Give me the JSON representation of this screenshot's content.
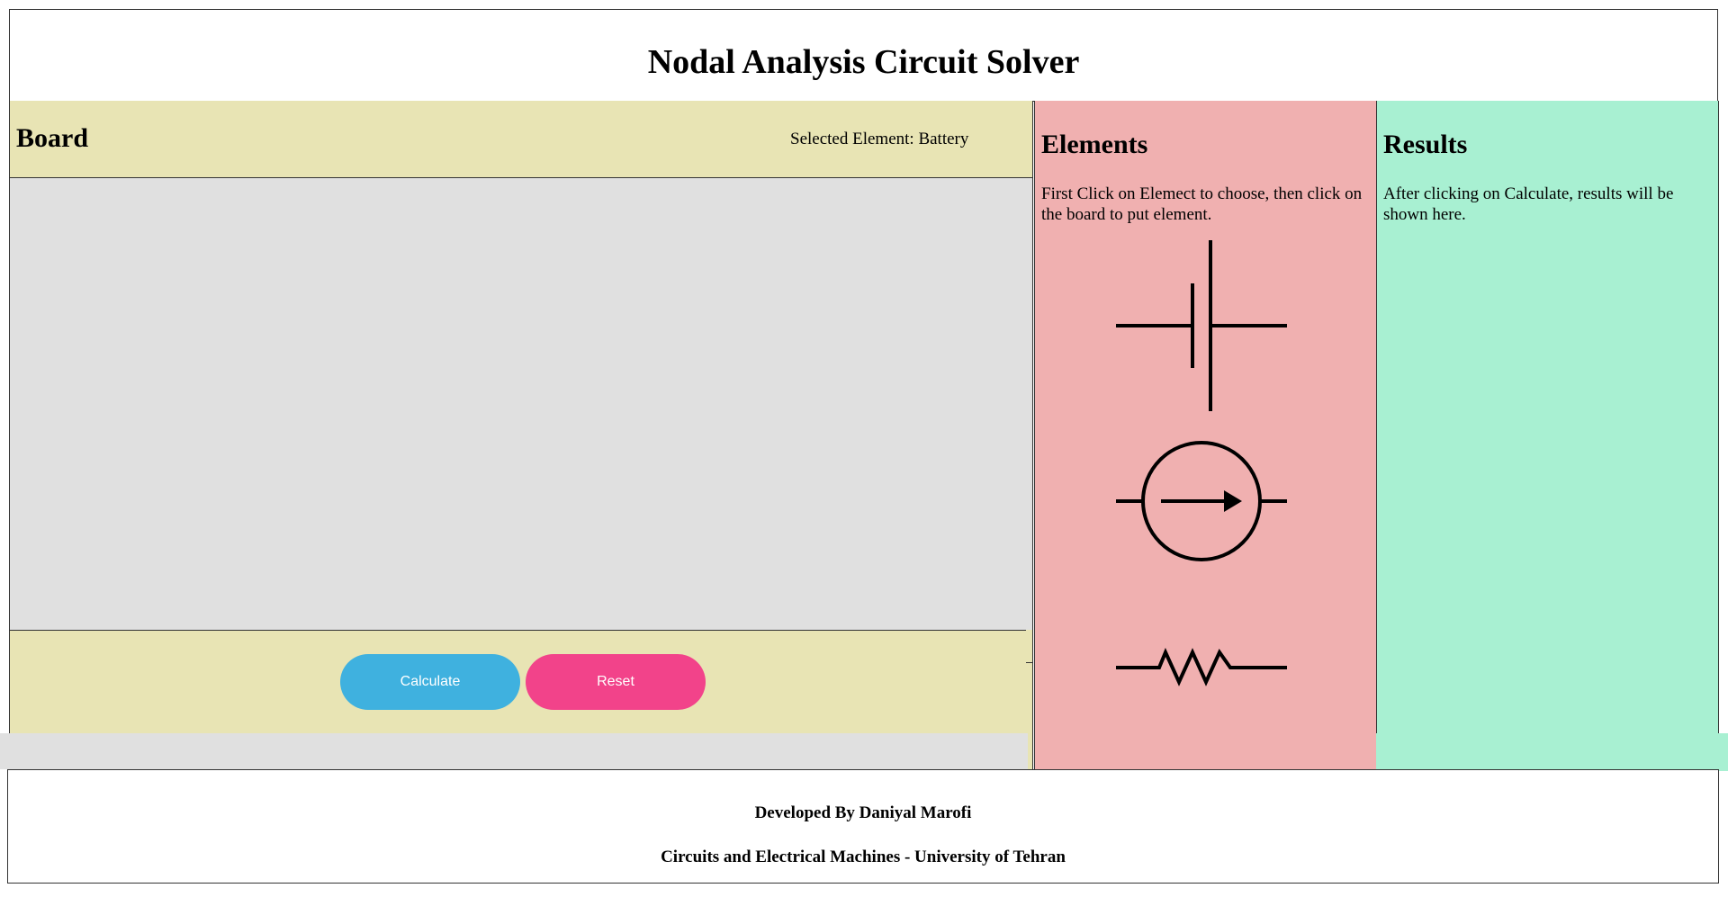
{
  "header": {
    "title": "Nodal Analysis Circuit Solver"
  },
  "board": {
    "title": "Board",
    "selected_label": "Selected Element: Battery",
    "calculate_label": "Calculate",
    "reset_label": "Reset"
  },
  "elements": {
    "title": "Elements",
    "instructions": "First Click on Elemect to choose, then click on the board to put element.",
    "items": [
      {
        "icon": "battery-icon"
      },
      {
        "icon": "current-source-icon"
      },
      {
        "icon": "resistor-icon"
      }
    ]
  },
  "results": {
    "title": "Results",
    "text": "After clicking on Calculate, results will be shown here."
  },
  "footer": {
    "developer": "Developed By Daniyal Marofi",
    "institution": "Circuits and Electrical Machines - University of Tehran"
  },
  "colors": {
    "board_bg": "#e8e4b4",
    "canvas_bg": "#e0e0e0",
    "elements_bg": "#f0b0b0",
    "results_bg": "#a8f0d2",
    "calculate_btn": "#3fb1df",
    "reset_btn": "#f2438a"
  }
}
